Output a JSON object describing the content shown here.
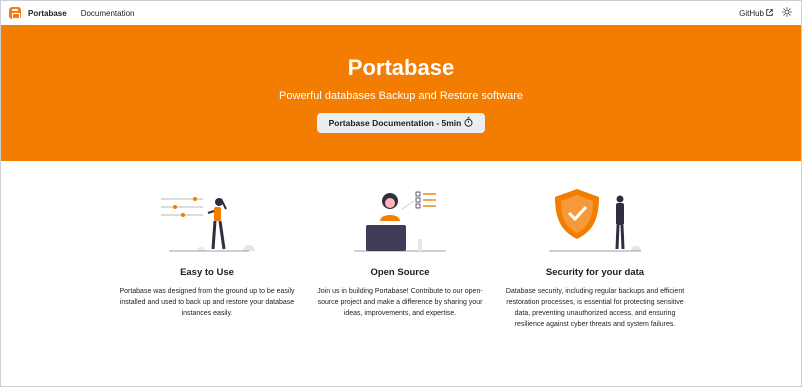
{
  "colors": {
    "accent": "#f27d00",
    "button_bg": "#ebedf0",
    "text": "#1c1e21"
  },
  "navbar": {
    "brand": "Portabase",
    "links": [
      "Documentation"
    ],
    "github": "GitHub",
    "icons": {
      "logo": "portabase-logo-icon",
      "external": "external-link-icon",
      "theme": "sun-icon"
    }
  },
  "hero": {
    "title": "Portabase",
    "subtitle": "Powerful databases Backup and Restore software",
    "button_label": "Portabase Documentation - 5min",
    "button_icon": "stopwatch-icon"
  },
  "features": [
    {
      "title": "Easy to Use",
      "text": "Portabase was designed from the ground up to be easily installed and used to back up and restore your database instances easily.",
      "illustration": "person-adjusting-sliders-illustration"
    },
    {
      "title": "Open Source",
      "text": "Join us in building Portabase! Contribute to our open-source project and make a difference by sharing your ideas, improvements, and expertise.",
      "illustration": "person-at-laptop-illustration"
    },
    {
      "title": "Security for your data",
      "text": "Database security, including regular backups and efficient restoration processes, is essential for protecting sensitive data, preventing unauthorized access, and ensuring resilience against cyber threats and system failures.",
      "illustration": "shield-with-person-illustration"
    }
  ]
}
